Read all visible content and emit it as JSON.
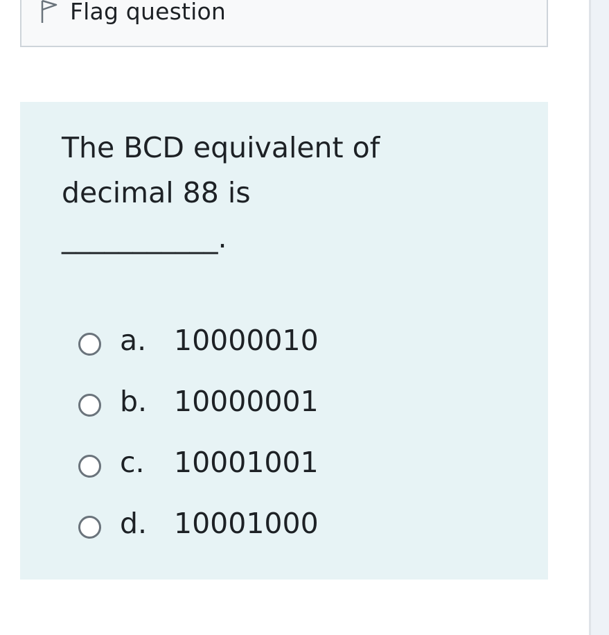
{
  "flag": {
    "label": "Flag question",
    "icon": "flag-icon"
  },
  "question": {
    "text": "The BCD equivalent of\ndecimal 88 is\n___________."
  },
  "answers": [
    {
      "letter": "a.",
      "text": "10000010"
    },
    {
      "letter": "b.",
      "text": "10000001"
    },
    {
      "letter": "c.",
      "text": "10001001"
    },
    {
      "letter": "d.",
      "text": "10001000"
    }
  ],
  "colors": {
    "panel": "#e7f3f5",
    "info_box": "#f8f9fa",
    "border": "#ced4da",
    "text": "#1d2125",
    "radio_border": "#6a737b"
  }
}
